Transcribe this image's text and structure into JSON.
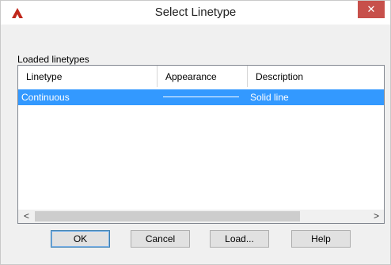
{
  "window": {
    "title": "Select Linetype",
    "close_glyph": "✕"
  },
  "list": {
    "section_label": "Loaded linetypes",
    "columns": [
      "Linetype",
      "Appearance",
      "Description"
    ],
    "rows": [
      {
        "linetype": "Continuous",
        "appearance": "solid-line",
        "description": "Solid line",
        "selected": true
      }
    ],
    "scroll_left_glyph": "<",
    "scroll_right_glyph": ">"
  },
  "buttons": {
    "ok": "OK",
    "cancel": "Cancel",
    "load": "Load...",
    "help": "Help"
  },
  "colors": {
    "selection": "#3399ff",
    "close": "#c7504b",
    "app_icon": "#c0281c"
  },
  "icons": {
    "app": "autocad-logo-icon",
    "close": "close-icon"
  }
}
